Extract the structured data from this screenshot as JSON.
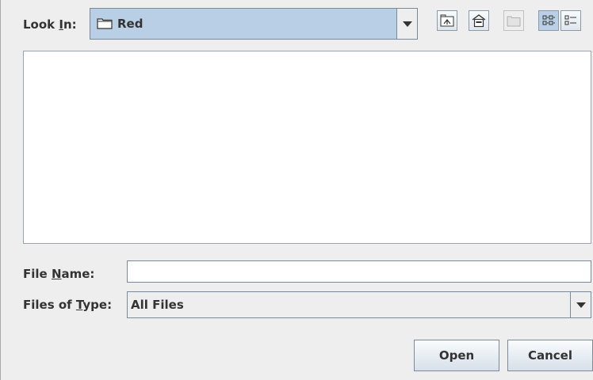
{
  "look_in": {
    "label_prefix": "Look ",
    "label_mnemonic": "I",
    "label_suffix": "n:",
    "value": "Red"
  },
  "toolbar": {
    "up_icon": "up-folder-icon",
    "home_icon": "home-icon",
    "new_folder_icon": "new-folder-icon",
    "list_view_icon": "list-view-icon",
    "details_view_icon": "details-view-icon"
  },
  "file_name": {
    "label_prefix": "File ",
    "label_mnemonic": "N",
    "label_suffix": "ame:",
    "value": ""
  },
  "files_of_type": {
    "label_prefix": "Files of ",
    "label_mnemonic": "T",
    "label_suffix": "ype:",
    "value": "All Files"
  },
  "buttons": {
    "open": "Open",
    "cancel": "Cancel"
  }
}
